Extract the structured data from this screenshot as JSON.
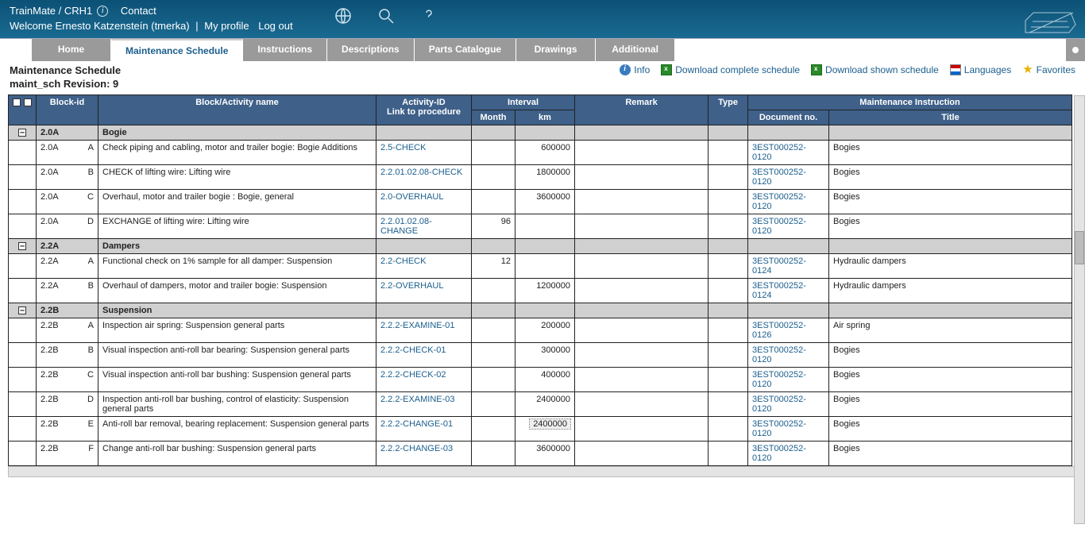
{
  "header": {
    "brand": "TrainMate / CRH1",
    "contact": "Contact",
    "welcome": "Welcome Ernesto Katzensteín (tmerka)",
    "profile": "My profile",
    "logout": "Log out"
  },
  "tabs": [
    "Home",
    "Maintenance Schedule",
    "Instructions",
    "Descriptions",
    "Parts Catalogue",
    "Drawings",
    "Additional"
  ],
  "active_tab": 1,
  "title": {
    "line1": "Maintenance Schedule",
    "line2": "maint_sch Revision: 9"
  },
  "toolbar": {
    "info": "Info",
    "dl_complete": "Download complete schedule",
    "dl_shown": "Download shown schedule",
    "languages": "Languages",
    "favorites": "Favorites"
  },
  "columns": {
    "block_id": "Block-id",
    "activity": "Block/Activity name",
    "activity_id": "Activity-ID\nLink to procedure",
    "interval": "Interval",
    "month": "Month",
    "km": "km",
    "remark": "Remark",
    "type": "Type",
    "minst": "Maintenance Instruction",
    "docno": "Document no.",
    "title": "Title"
  },
  "groups": [
    {
      "bid": "2.0A",
      "name": "Bogie",
      "rows": [
        {
          "bid": "2.0A",
          "sub": "A",
          "act": "Check piping and cabling, motor and trailer bogie: Bogie Additions",
          "aid": "2.5-CHECK",
          "mon": "",
          "km": "600000",
          "doc": "3EST000252-0120",
          "title": "Bogies"
        },
        {
          "bid": "2.0A",
          "sub": "B",
          "act": "CHECK of lifting wire: Lifting wire",
          "aid": "2.2.01.02.08-CHECK",
          "mon": "",
          "km": "1800000",
          "doc": "3EST000252-0120",
          "title": "Bogies"
        },
        {
          "bid": "2.0A",
          "sub": "C",
          "act": "Overhaul, motor and trailer bogie : Bogie, general",
          "aid": "2.0-OVERHAUL",
          "mon": "",
          "km": "3600000",
          "doc": "3EST000252-0120",
          "title": "Bogies"
        },
        {
          "bid": "2.0A",
          "sub": "D",
          "act": "EXCHANGE of lifting wire: Lifting wire",
          "aid": "2.2.01.02.08-CHANGE",
          "mon": "96",
          "km": "",
          "doc": "3EST000252-0120",
          "title": "Bogies"
        }
      ]
    },
    {
      "bid": "2.2A",
      "name": "Dampers",
      "rows": [
        {
          "bid": "2.2A",
          "sub": "A",
          "act": "Functional check on 1% sample for all damper: Suspension",
          "aid": "2.2-CHECK",
          "mon": "12",
          "km": "",
          "doc": "3EST000252-0124",
          "title": "Hydraulic dampers"
        },
        {
          "bid": "2.2A",
          "sub": "B",
          "act": "Overhaul of dampers, motor and trailer bogie: Suspension",
          "aid": "2.2-OVERHAUL",
          "mon": "",
          "km": "1200000",
          "doc": "3EST000252-0124",
          "title": "Hydraulic dampers"
        }
      ]
    },
    {
      "bid": "2.2B",
      "name": "Suspension",
      "rows": [
        {
          "bid": "2.2B",
          "sub": "A",
          "act": "Inspection air spring: Suspension general parts",
          "aid": "2.2.2-EXAMINE-01",
          "mon": "",
          "km": "200000",
          "doc": "3EST000252-0126",
          "title": "Air spring"
        },
        {
          "bid": "2.2B",
          "sub": "B",
          "act": "Visual inspection anti-roll bar bearing: Suspension general parts",
          "aid": "2.2.2-CHECK-01",
          "mon": "",
          "km": "300000",
          "doc": "3EST000252-0120",
          "title": "Bogies"
        },
        {
          "bid": "2.2B",
          "sub": "C",
          "act": "Visual inspection anti-roll bar bushing: Suspension general parts",
          "aid": "2.2.2-CHECK-02",
          "mon": "",
          "km": "400000",
          "doc": "3EST000252-0120",
          "title": "Bogies"
        },
        {
          "bid": "2.2B",
          "sub": "D",
          "act": "Inspection anti-roll bar bushing, control of elasticity: Suspension general parts",
          "aid": "2.2.2-EXAMINE-03",
          "mon": "",
          "km": "2400000",
          "doc": "3EST000252-0120",
          "title": "Bogies"
        },
        {
          "bid": "2.2B",
          "sub": "E",
          "act": "Anti-roll bar removal, bearing replacement: Suspension general parts",
          "aid": "2.2.2-CHANGE-01",
          "mon": "",
          "km": "2400000",
          "doc": "3EST000252-0120",
          "title": "Bogies",
          "sel": true
        },
        {
          "bid": "2.2B",
          "sub": "F",
          "act": "Change anti-roll bar bushing: Suspension general parts",
          "aid": "2.2.2-CHANGE-03",
          "mon": "",
          "km": "3600000",
          "doc": "3EST000252-0120",
          "title": "Bogies"
        }
      ]
    }
  ]
}
